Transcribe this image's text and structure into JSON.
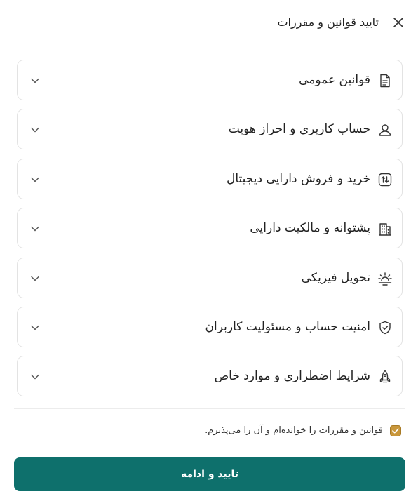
{
  "dialog": {
    "title": "تایید قوانین و مقررات",
    "close_icon": "close-icon"
  },
  "sections": [
    {
      "label": "قوانین عمومی",
      "icon": "document-icon"
    },
    {
      "label": "حساب کاربری و احراز هویت",
      "icon": "user-icon"
    },
    {
      "label": "خرید و فروش دارایی دیجیتال",
      "icon": "exchange-icon"
    },
    {
      "label": "پشتوانه و مالکیت دارایی",
      "icon": "building-icon"
    },
    {
      "label": "تحویل فیزیکی",
      "icon": "delivery-icon"
    },
    {
      "label": "امنیت حساب و مسئولیت کاربران",
      "icon": "shield-icon"
    },
    {
      "label": "شرایط اضطراری و موارد خاص",
      "icon": "rocket-icon"
    }
  ],
  "agreement": {
    "label": "قوانین و مقررات را خوانده‌ام و آن را می‌پذیرم.",
    "checked": true,
    "checkbox_color": "#c9973b"
  },
  "submit": {
    "label": "تایید و ادامه",
    "color": "#0e706c"
  }
}
